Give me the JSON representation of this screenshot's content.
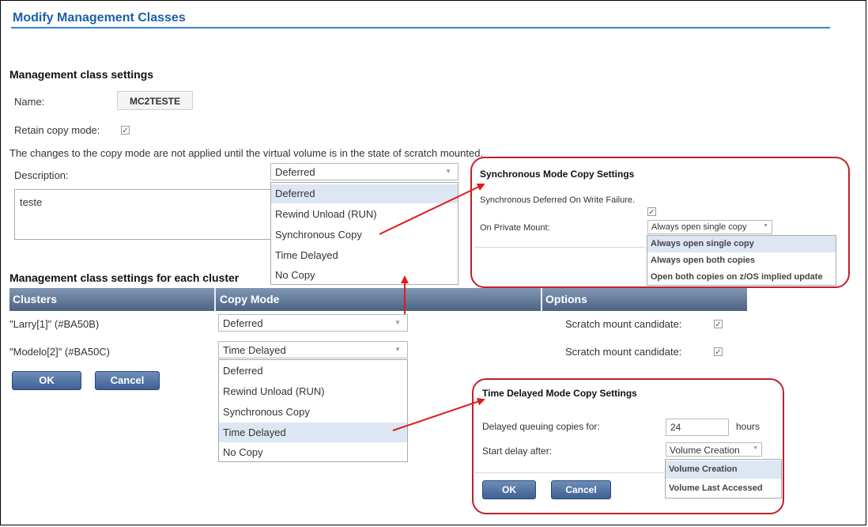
{
  "page": {
    "title": "Modify Management Classes"
  },
  "settings": {
    "heading": "Management class settings",
    "name_label": "Name:",
    "name_value": "MC2TESTE",
    "retain_label": "Retain copy mode:",
    "retain_checked": "✓",
    "notice": "The changes to the copy mode are not applied until the virtual volume is in the state of scratch mounted.",
    "description_label": "Description:",
    "description_value": "teste"
  },
  "copy_mode_dropdown": {
    "selected": "Deferred",
    "options": [
      "Deferred",
      "Rewind Unload (RUN)",
      "Synchronous Copy",
      "Time Delayed",
      "No Copy"
    ]
  },
  "cluster_section": {
    "heading": "Management class settings for each cluster",
    "columns": [
      "Clusters",
      "Copy Mode",
      "Options"
    ],
    "rows": [
      {
        "cluster": "\"Larry[1]\" (#BA50B)",
        "copy_mode": "Deferred",
        "option_label": "Scratch mount candidate:",
        "checked": "✓"
      },
      {
        "cluster": "\"Modelo[2]\" (#BA50C)",
        "copy_mode": "Time Delayed",
        "option_label": "Scratch mount candidate:",
        "checked": "✓"
      }
    ],
    "row2_dropdown_options": [
      "Deferred",
      "Rewind Unload (RUN)",
      "Synchronous Copy",
      "Time Delayed",
      "No Copy"
    ],
    "ok_label": "OK",
    "cancel_label": "Cancel"
  },
  "sync_callout": {
    "title": "Synchronous Mode Copy Settings",
    "deferred_label": "Synchronous Deferred On Write Failure.",
    "deferred_checked": "✓",
    "private_mount_label": "On Private Mount:",
    "private_mount_selected": "Always open single copy",
    "private_mount_options": [
      "Always open single copy",
      "Always open both copies",
      "Open both copies on z/OS implied update"
    ]
  },
  "delay_callout": {
    "title": "Time Delayed Mode Copy Settings",
    "queue_label": "Delayed queuing copies for:",
    "queue_value": "24",
    "queue_unit": "hours",
    "start_label": "Start delay after:",
    "start_selected": "Volume Creation",
    "start_options": [
      "Volume Creation",
      "Volume Last Accessed"
    ],
    "ok_label": "OK",
    "cancel_label": "Cancel"
  },
  "colors": {
    "accent": "#1d5fa8",
    "callout": "#c0202a",
    "table_header": "#4b6384",
    "button": "#3f6095"
  }
}
